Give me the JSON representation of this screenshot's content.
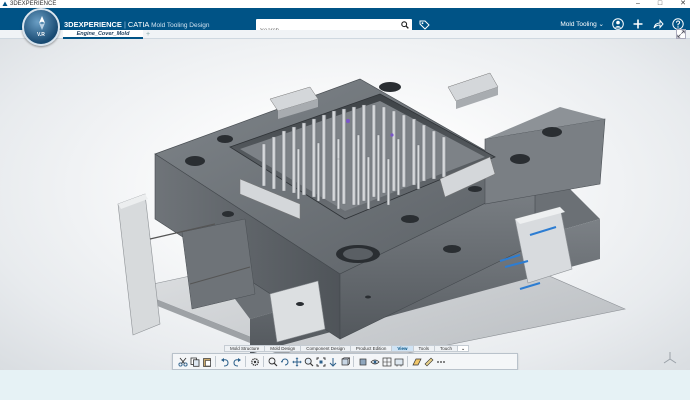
{
  "window": {
    "title": "3DEXPERIENCE",
    "controls": [
      "–",
      "□",
      "✕"
    ]
  },
  "topbar": {
    "brand_bold": "3DEXPERIENCE",
    "brand_sep": "|",
    "brand_app": "CATIA",
    "brand_role": "Mold Tooling Design",
    "compass_version": "V.R",
    "search": {
      "value": "",
      "placeholder": "Search"
    },
    "workspace": "Mold Tooling"
  },
  "tabs": {
    "active": "Engine_Cover_Mold",
    "add": "+"
  },
  "action_tabs": [
    {
      "label": "Mold Structure",
      "active": false
    },
    {
      "label": "Mold Design",
      "active": false
    },
    {
      "label": "Component Design",
      "active": false
    },
    {
      "label": "Product Edition",
      "active": false
    },
    {
      "label": "View",
      "active": true
    },
    {
      "label": "Tools",
      "active": false
    },
    {
      "label": "Touch",
      "active": false
    }
  ],
  "action_toggle": "⌄",
  "action_icons": [
    "scissors-icon",
    "copy-icon",
    "paste-icon",
    "undo-icon",
    "redo-icon",
    "settings-icon",
    "zoom-in-icon",
    "rotate-icon",
    "pan-icon",
    "zoom-icon",
    "fit-all-icon",
    "normal-view-icon",
    "view-mode-icon",
    "render-style-icon",
    "hide-show-icon",
    "swap-space-icon",
    "display-options-icon",
    "sectioning-icon",
    "measure-icon",
    "more-icon"
  ],
  "colors": {
    "topbar": "#005386",
    "accent": "#1b6bb8",
    "steel_dark": "#5f6469",
    "steel_mid": "#8a9095",
    "steel_light": "#c9cdd1",
    "bottombar": "#e6f2f5"
  }
}
